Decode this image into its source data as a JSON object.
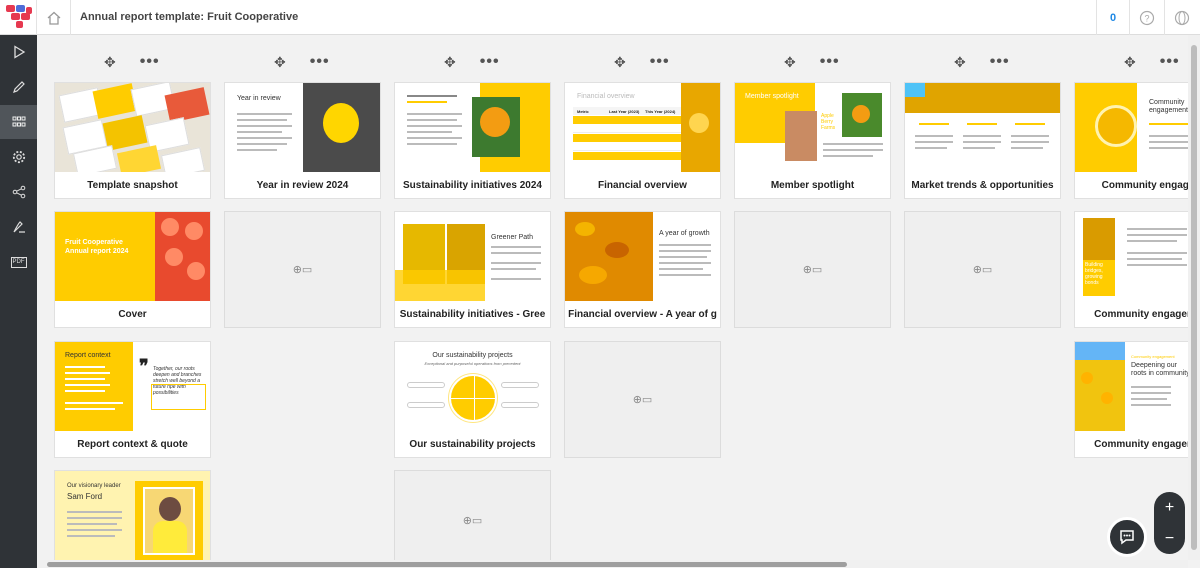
{
  "header": {
    "title": "Annual report template: Fruit Cooperative",
    "notification_count": "0"
  },
  "colors": {
    "accent": "#ffcc00",
    "sidebar": "#2f3337",
    "badge": "#1e88e5"
  },
  "cards": {
    "template_snapshot": "Template snapshot",
    "year_review": "Year in review 2024",
    "year_review_thumb": "Year in review",
    "sustainability": "Sustainability initiatives 2024",
    "financial": "Financial overview",
    "financial_thumb": "Financial overview",
    "member": "Member spotlight",
    "member_thumb": "Member spotlight",
    "market": "Market trends & opportunities",
    "community": "Community engagem",
    "community_thumb": "Community engagement",
    "cover": "Cover",
    "cover_title": "Fruit Cooperative Annual report 2024",
    "sust_green": "Sustainability initiatives - Gree",
    "greener_thumb": "Greener Path",
    "fin_growth": "Financial overview - A year of g",
    "growth_thumb": "A year of growth",
    "community2": "Community engagement",
    "building_thumb": "Building bridges, growing bonds",
    "report_context": "Report context & quote",
    "report_context_thumb": "Report context",
    "quote_thumb": "Together, our roots deepen and branches stretch well beyond a future ripe with possibilities",
    "projects": "Our sustainability projects",
    "projects_thumb": "Our sustainability projects",
    "projects_sub": "Exceptional and purposeful operations from precedent",
    "community3": "Community engagement",
    "deepening_thumb": "Deepening our roots in community",
    "leader_thumb": "Our visionary leader",
    "leader_name": "Sam Ford",
    "table_headers": [
      "Metric",
      "Last Year (2023)",
      "This Year (2024)"
    ]
  },
  "icons": {
    "sidebar": [
      "play-icon",
      "pencil-icon",
      "grid-icon",
      "gear-icon",
      "share-icon",
      "signature-icon",
      "pdf-icon"
    ]
  },
  "sidebar_labels": {
    "pdf": "PDF"
  },
  "zoom": {
    "plus": "+",
    "minus": "−"
  }
}
